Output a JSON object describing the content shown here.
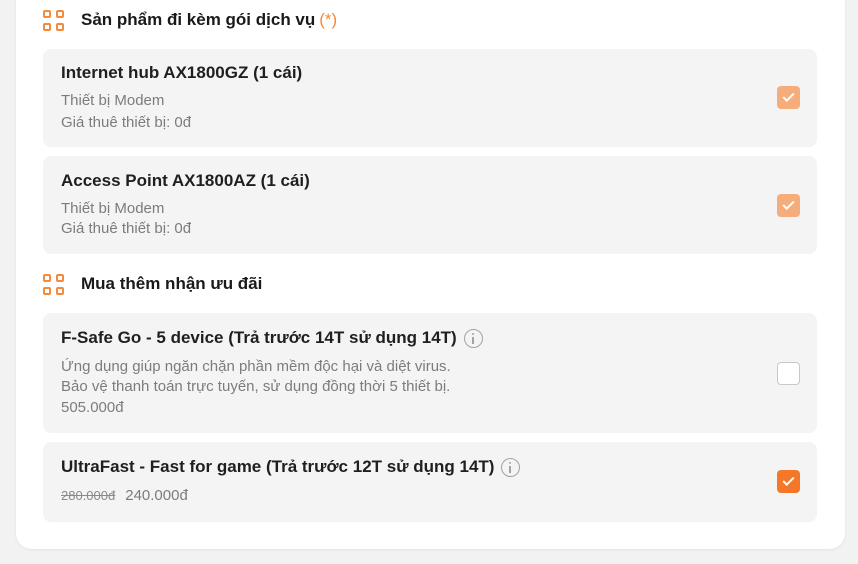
{
  "sections": [
    {
      "title": "Sản phẩm đi kèm gói dịch vụ",
      "required_mark": "(*)",
      "items": [
        {
          "title": "Internet hub AX1800GZ (1 cái)",
          "lines": [
            "Thiết bị Modem",
            "Giá thuê thiết bị: 0đ"
          ],
          "state": "checked-disabled"
        },
        {
          "title": "Access Point AX1800AZ (1 cái)",
          "lines": [
            "Thiết bị Modem",
            "Giá thuê thiết bị: 0đ"
          ],
          "state": "checked-disabled"
        }
      ]
    },
    {
      "title": "Mua thêm nhận ưu đãi",
      "items": [
        {
          "title": "F-Safe Go - 5 device (Trả trước 14T sử dụng 14T)",
          "lines": [
            "Ứng dụng giúp ngăn chặn phần mềm độc hại và diệt virus.",
            "Bảo vệ thanh toán trực tuyến, sử dụng đồng thời 5 thiết bị.",
            "505.000đ"
          ],
          "state": "unchecked",
          "has_info": true
        },
        {
          "title": "UltraFast - Fast for game (Trả trước 12T sử dụng 14T)",
          "old_price": "280.000đ",
          "new_price": "240.000đ",
          "state": "checked",
          "has_info": true
        }
      ]
    }
  ],
  "colors": {
    "accent": "#f58a3b",
    "checked": "#f5772a",
    "checked_disabled": "#f5ad7c",
    "card_bg": "#f4f4f4"
  },
  "icons": {
    "section": "grid-icon",
    "info": "info-icon",
    "check": "checkmark-icon"
  }
}
